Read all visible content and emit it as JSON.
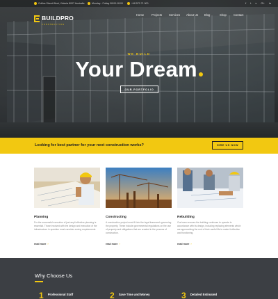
{
  "topbar": {
    "address": "Collins Street West, Victoria 8007 Australia",
    "hours": "Monday - Friday 08:00-18:00",
    "phone": "+48 570 71 000",
    "social": [
      "f",
      "t",
      "v",
      "G+",
      "in"
    ]
  },
  "logo": {
    "name": "BUILDPRO",
    "tag": "CONSTRUCTION"
  },
  "nav": [
    "Home",
    "Projects",
    "Services",
    "About Us",
    "Blog",
    "Shop",
    "Contact"
  ],
  "hero": {
    "kicker": "WE BUILD",
    "headline": "Your Dream",
    "button": "OUR PORTFOLIO"
  },
  "cta": {
    "text": "Looking for best partner for your next construction works?",
    "button": "HIRE US NOW"
  },
  "services": [
    {
      "title": "Planning",
      "text": "For the successful execution of just any/t effective planning is essential. Those involved with the design and execution of the infrastructure in question must consider zoning requirements.",
      "more": "read more"
    },
    {
      "title": "Constructing",
      "text": "A construction project must fit into the legal framework governing the property. These include governmental regulations on the use of property and obligations that are created in the process of construction.",
      "more": "read more"
    },
    {
      "title": "Rebuilding",
      "text": "Our team ensures the building continues to operate in accordance with its design, including replacing elements which are approaching the end of their useful life to make it effective and functioning.",
      "more": "read more"
    }
  ],
  "why": {
    "title": "Why Choose Us",
    "items": [
      {
        "num": "1",
        "label": "Professional Staff"
      },
      {
        "num": "2",
        "label": "Save Time and Money"
      },
      {
        "num": "3",
        "label": "Detailed Estimated"
      }
    ]
  },
  "colors": {
    "accent": "#f2c811",
    "dark": "#3c3f44"
  }
}
